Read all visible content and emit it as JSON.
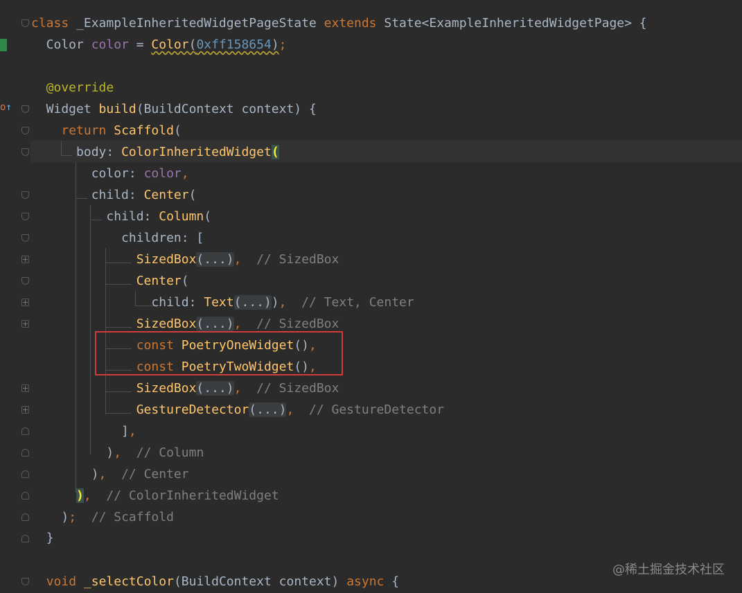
{
  "code": {
    "l1": {
      "class_kw": "class",
      "class_name": " _ExampleInheritedWidgetPageState ",
      "extends_kw": "extends",
      "rest": " State<ExampleInheritedWidgetPage> {"
    },
    "l2": {
      "type": "  Color ",
      "field": "color",
      "eq": " = ",
      "ctor": "Color",
      "open": "(",
      "num": "0xff158654",
      "close": ")",
      "semi": ";"
    },
    "l4": {
      "ann": "  @override"
    },
    "l5": {
      "type": "  Widget ",
      "fn": "build",
      "rest": "(BuildContext context) {"
    },
    "l6": {
      "ind": "    ",
      "kw": "return",
      "sp": " ",
      "fn": "Scaffold",
      "rest": "("
    },
    "l7": {
      "ind": "      ",
      "label": "body: ",
      "fn": "ColorInheritedWidget",
      "paren": "("
    },
    "l8": {
      "ind": "        ",
      "label": "color: ",
      "field": "color",
      "comma": ","
    },
    "l9": {
      "ind": "        ",
      "label": "child: ",
      "fn": "Center",
      "rest": "("
    },
    "l10": {
      "ind": "          ",
      "label": "child: ",
      "fn": "Column",
      "rest": "("
    },
    "l11": {
      "ind": "            ",
      "text": "children: ["
    },
    "l12": {
      "ind": "              ",
      "fn": "SizedBox",
      "fold": "(...)",
      "comma": ",",
      "sp": "  ",
      "cmt": "// SizedBox"
    },
    "l13": {
      "ind": "              ",
      "fn": "Center",
      "rest": "("
    },
    "l14": {
      "ind": "                ",
      "label": "child: ",
      "fn": "Text",
      "fold": "(...)",
      "close": ")",
      "comma": ",",
      "sp": "  ",
      "cmt": "// Text, Center"
    },
    "l15": {
      "ind": "              ",
      "fn": "SizedBox",
      "fold": "(...)",
      "comma": ",",
      "sp": "  ",
      "cmt": "// SizedBox"
    },
    "l16": {
      "ind": "              ",
      "kw": "const",
      "sp": " ",
      "fn": "PoetryOneWidget",
      "rest": "()",
      "comma": ","
    },
    "l17": {
      "ind": "              ",
      "kw": "const",
      "sp": " ",
      "fn": "PoetryTwoWidget",
      "rest": "()",
      "comma": ","
    },
    "l18": {
      "ind": "              ",
      "fn": "SizedBox",
      "fold": "(...)",
      "comma": ",",
      "sp": "  ",
      "cmt": "// SizedBox"
    },
    "l19": {
      "ind": "              ",
      "fn": "GestureDetector",
      "fold": "(...)",
      "comma": ",",
      "sp": "  ",
      "cmt": "// GestureDetector"
    },
    "l20": {
      "ind": "            ",
      "text": "]",
      "comma": ","
    },
    "l21": {
      "ind": "          ",
      "text": ")",
      "comma": ",",
      "sp": "  ",
      "cmt": "// Column"
    },
    "l22": {
      "ind": "        ",
      "text": ")",
      "comma": ",",
      "sp": "  ",
      "cmt": "// Center"
    },
    "l23": {
      "ind": "      ",
      "paren": ")",
      "comma": ",",
      "sp": "  ",
      "cmt": "// ColorInheritedWidget"
    },
    "l24": {
      "ind": "    ",
      "text": ")",
      "semi": ";",
      "sp": "  ",
      "cmt": "// Scaffold"
    },
    "l25": {
      "ind": "  ",
      "text": "}"
    },
    "l27": {
      "ind": "  ",
      "kw": "void",
      "sp": " ",
      "fn": "_selectColor",
      "rest": "(BuildContext context) ",
      "kw2": "async",
      "end": " {"
    }
  },
  "watermark": "@稀土掘金技术社区",
  "colors": {
    "background": "#2b2b2b",
    "keyword": "#cc7832",
    "function": "#ffc66d",
    "field": "#9876aa",
    "number": "#6897bb",
    "annotation": "#bbb529",
    "comment": "#808080",
    "highlight_box": "#d23c3c"
  },
  "icons": {
    "gutter_change": "vcs-change-marker",
    "override": "override-method-icon",
    "fold": "code-fold-icon"
  }
}
